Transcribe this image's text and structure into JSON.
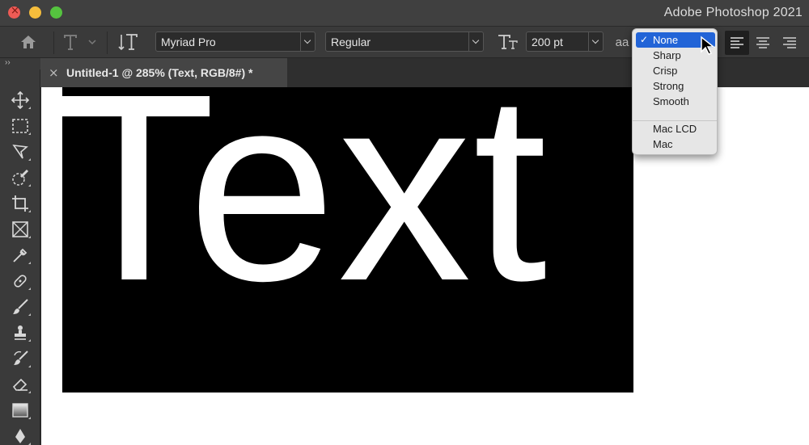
{
  "window": {
    "app_title": "Adobe Photoshop 2021"
  },
  "options_bar": {
    "font_family": "Myriad Pro",
    "font_style": "Regular",
    "font_size": "200 pt",
    "antialias_label": "aa"
  },
  "antialias_menu": {
    "items": [
      {
        "label": "None",
        "selected": true
      },
      {
        "label": "Sharp",
        "selected": false
      },
      {
        "label": "Crisp",
        "selected": false
      },
      {
        "label": "Strong",
        "selected": false
      },
      {
        "label": "Smooth",
        "selected": false
      },
      {
        "label": "Mac LCD",
        "selected": false
      },
      {
        "label": "Mac",
        "selected": false
      }
    ],
    "check_mark": "✓"
  },
  "document": {
    "tab_label": "Untitled-1 @ 285% (Text, RGB/8#) *",
    "canvas_text": "Text"
  },
  "tools": [
    "move-tool-icon",
    "marquee-tool-icon",
    "lasso-tool-icon",
    "quick-selection-tool-icon",
    "crop-tool-icon",
    "frame-tool-icon",
    "eyedropper-tool-icon",
    "healing-brush-tool-icon",
    "brush-tool-icon",
    "clone-stamp-tool-icon",
    "history-brush-tool-icon",
    "eraser-tool-icon",
    "gradient-tool-icon",
    "pen-tool-icon"
  ],
  "colors": {
    "menu_highlight": "#2264d7",
    "canvas_bg": "#ffffff",
    "text_layer_bg": "#000000"
  }
}
